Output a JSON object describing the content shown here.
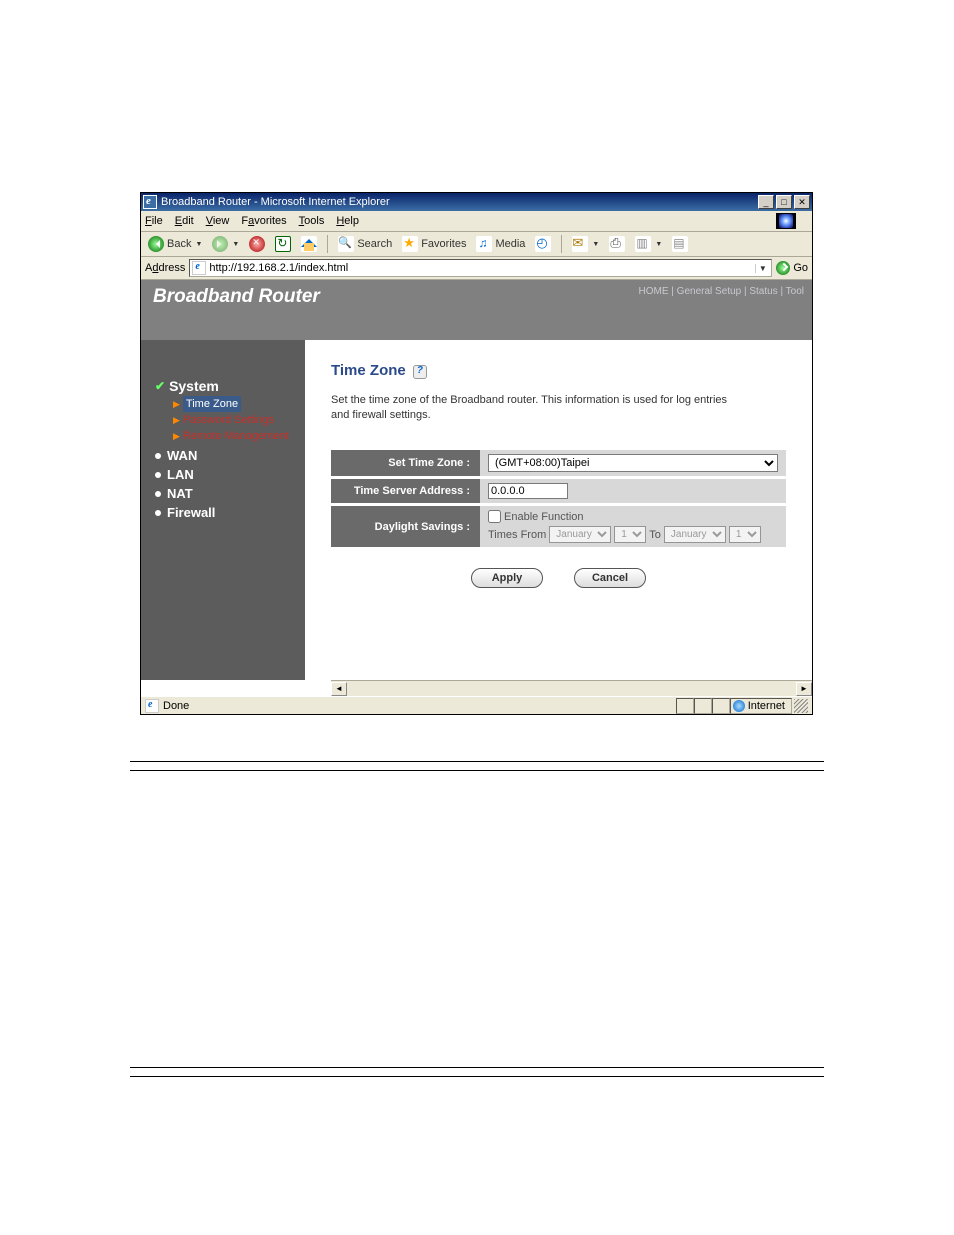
{
  "window": {
    "title": "Broadband Router - Microsoft Internet Explorer",
    "min": "_",
    "max": "□",
    "close": "✕"
  },
  "menus": {
    "file": "File",
    "edit": "Edit",
    "view": "View",
    "favorites": "Favorites",
    "tools": "Tools",
    "help": "Help"
  },
  "toolbar": {
    "back": "Back",
    "search": "Search",
    "favorites": "Favorites",
    "media": "Media"
  },
  "address": {
    "label": "Address",
    "url": "http://192.168.2.1/index.html",
    "go": "Go"
  },
  "header": {
    "brand": "Broadband Router",
    "nav": "HOME | General Setup | Status | Tool"
  },
  "sidebar": {
    "system": "System",
    "timezone": "Time Zone",
    "password": "Password Settings",
    "remote": "Remote Management",
    "wan": "WAN",
    "lan": "LAN",
    "nat": "NAT",
    "firewall": "Firewall"
  },
  "main": {
    "heading": "Time Zone",
    "desc": "Set the time zone of the Broadband router. This information is used for log entries and firewall settings.",
    "labels": {
      "tz": "Set Time Zone :",
      "ts": "Time Server Address :",
      "ds": "Daylight Savings :"
    },
    "tz_value": "(GMT+08:00)Taipei",
    "ts_value": "0.0.0.0",
    "ds": {
      "enable": "Enable Function",
      "times_from": "Times From",
      "to": "To",
      "month": "January",
      "day": "1"
    },
    "buttons": {
      "apply": "Apply",
      "cancel": "Cancel"
    }
  },
  "status": {
    "done": "Done",
    "zone": "Internet"
  }
}
